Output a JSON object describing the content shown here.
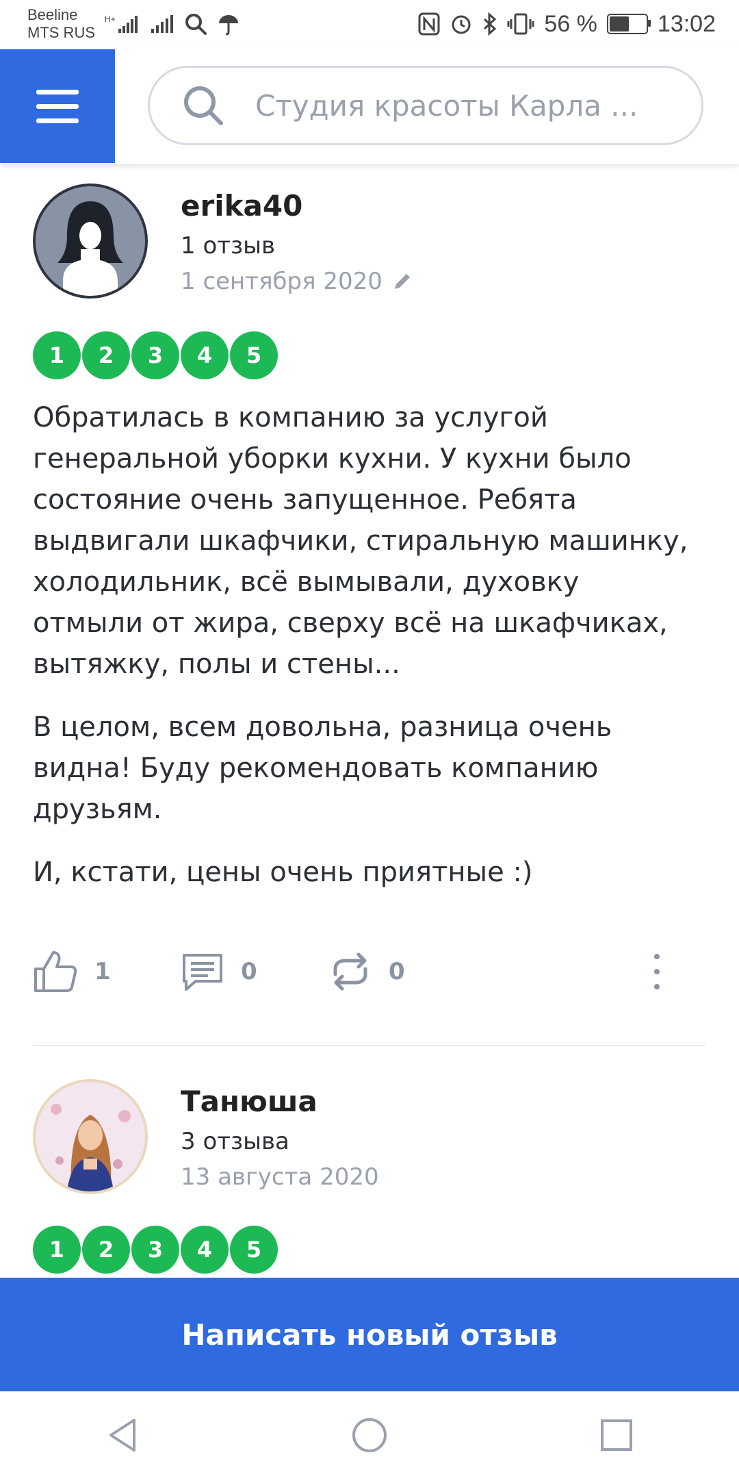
{
  "status_bar": {
    "carrier1": "Beeline",
    "carrier2": "MTS RUS",
    "battery_percent": "56 %",
    "time": "13:02"
  },
  "header": {
    "search_text": "Студия красоты Карла ..."
  },
  "reviews": [
    {
      "name": "erika40",
      "count": "1 отзыв",
      "date": "1 сентября 2020",
      "rating": [
        "1",
        "2",
        "3",
        "4",
        "5"
      ],
      "paragraphs": [
        "Обратилась в компанию за услугой генеральной уборки кухни. У кухни было состояние очень запущенное. Ребята выдвигали шкафчики, стиральную машинку, холодильник, всё вымывали, духовку отмыли от жира, сверху всё на шкафчиках, вытяжку, полы и стены...",
        "В целом, всем довольна, разница очень видна! Буду рекомендовать компанию друзьям.",
        "И, кстати, цены очень приятные :)"
      ],
      "likes": "1",
      "comments": "0",
      "reposts": "0"
    },
    {
      "name": "Танюша",
      "count": "3 отзыва",
      "date": "13 августа 2020",
      "rating": [
        "1",
        "2",
        "3",
        "4",
        "5"
      ]
    }
  ],
  "cta_label": "Написать новый отзыв",
  "icons": {
    "menu": "hamburger-icon",
    "search": "search-icon",
    "edit": "pencil-icon",
    "like": "thumbs-up-icon",
    "comment": "comment-icon",
    "repost": "repost-icon",
    "more": "more-vertical-icon",
    "back": "nav-back-icon",
    "home": "nav-home-icon",
    "recent": "nav-recent-icon"
  },
  "colors": {
    "accent": "#2f6ae0",
    "rating": "#1db954",
    "muted": "#9aa1ad"
  }
}
